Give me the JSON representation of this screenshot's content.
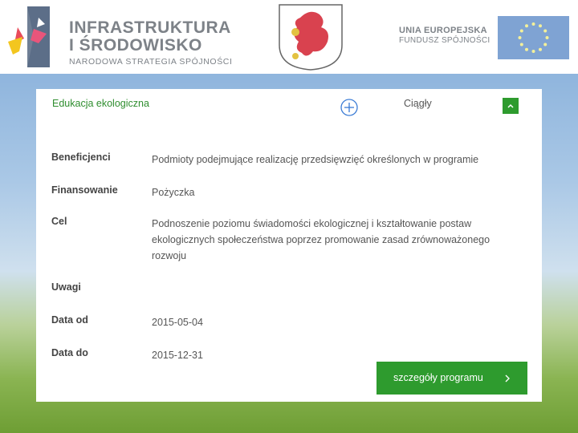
{
  "header": {
    "logo": {
      "line1": "INFRASTRUKTURA",
      "line2": "I ŚRODOWISKO",
      "line3": "NARODOWA STRATEGIA SPÓJNOŚCI"
    },
    "eu": {
      "line1": "UNIA EUROPEJSKA",
      "line2": "FUNDUSZ SPÓJNOŚCI"
    }
  },
  "program": {
    "title": "Edukacja ekologiczna",
    "type": "Ciągły",
    "fields": [
      {
        "label": "Beneficjenci",
        "value": "Podmioty podejmujące realizację przedsięwzięć określonych w programie"
      },
      {
        "label": "Finansowanie",
        "value": "Pożyczka"
      },
      {
        "label": "Cel",
        "value": "Podnoszenie poziomu świadomości ekologicznej i kształtowanie postaw ekologicznych społeczeństwa poprzez promowanie zasad zrównoważonego rozwoju"
      },
      {
        "label": "Uwagi",
        "value": ""
      },
      {
        "label": "Data od",
        "value": "2015-05-04"
      },
      {
        "label": "Data do",
        "value": "2015-12-31"
      }
    ],
    "details_label": "szczegóły programu"
  },
  "colors": {
    "accent": "#2e9b2e",
    "title": "#2f8e2f"
  },
  "icons": [
    "plus-circle-icon",
    "chevron-up-icon",
    "chevron-right-icon"
  ]
}
